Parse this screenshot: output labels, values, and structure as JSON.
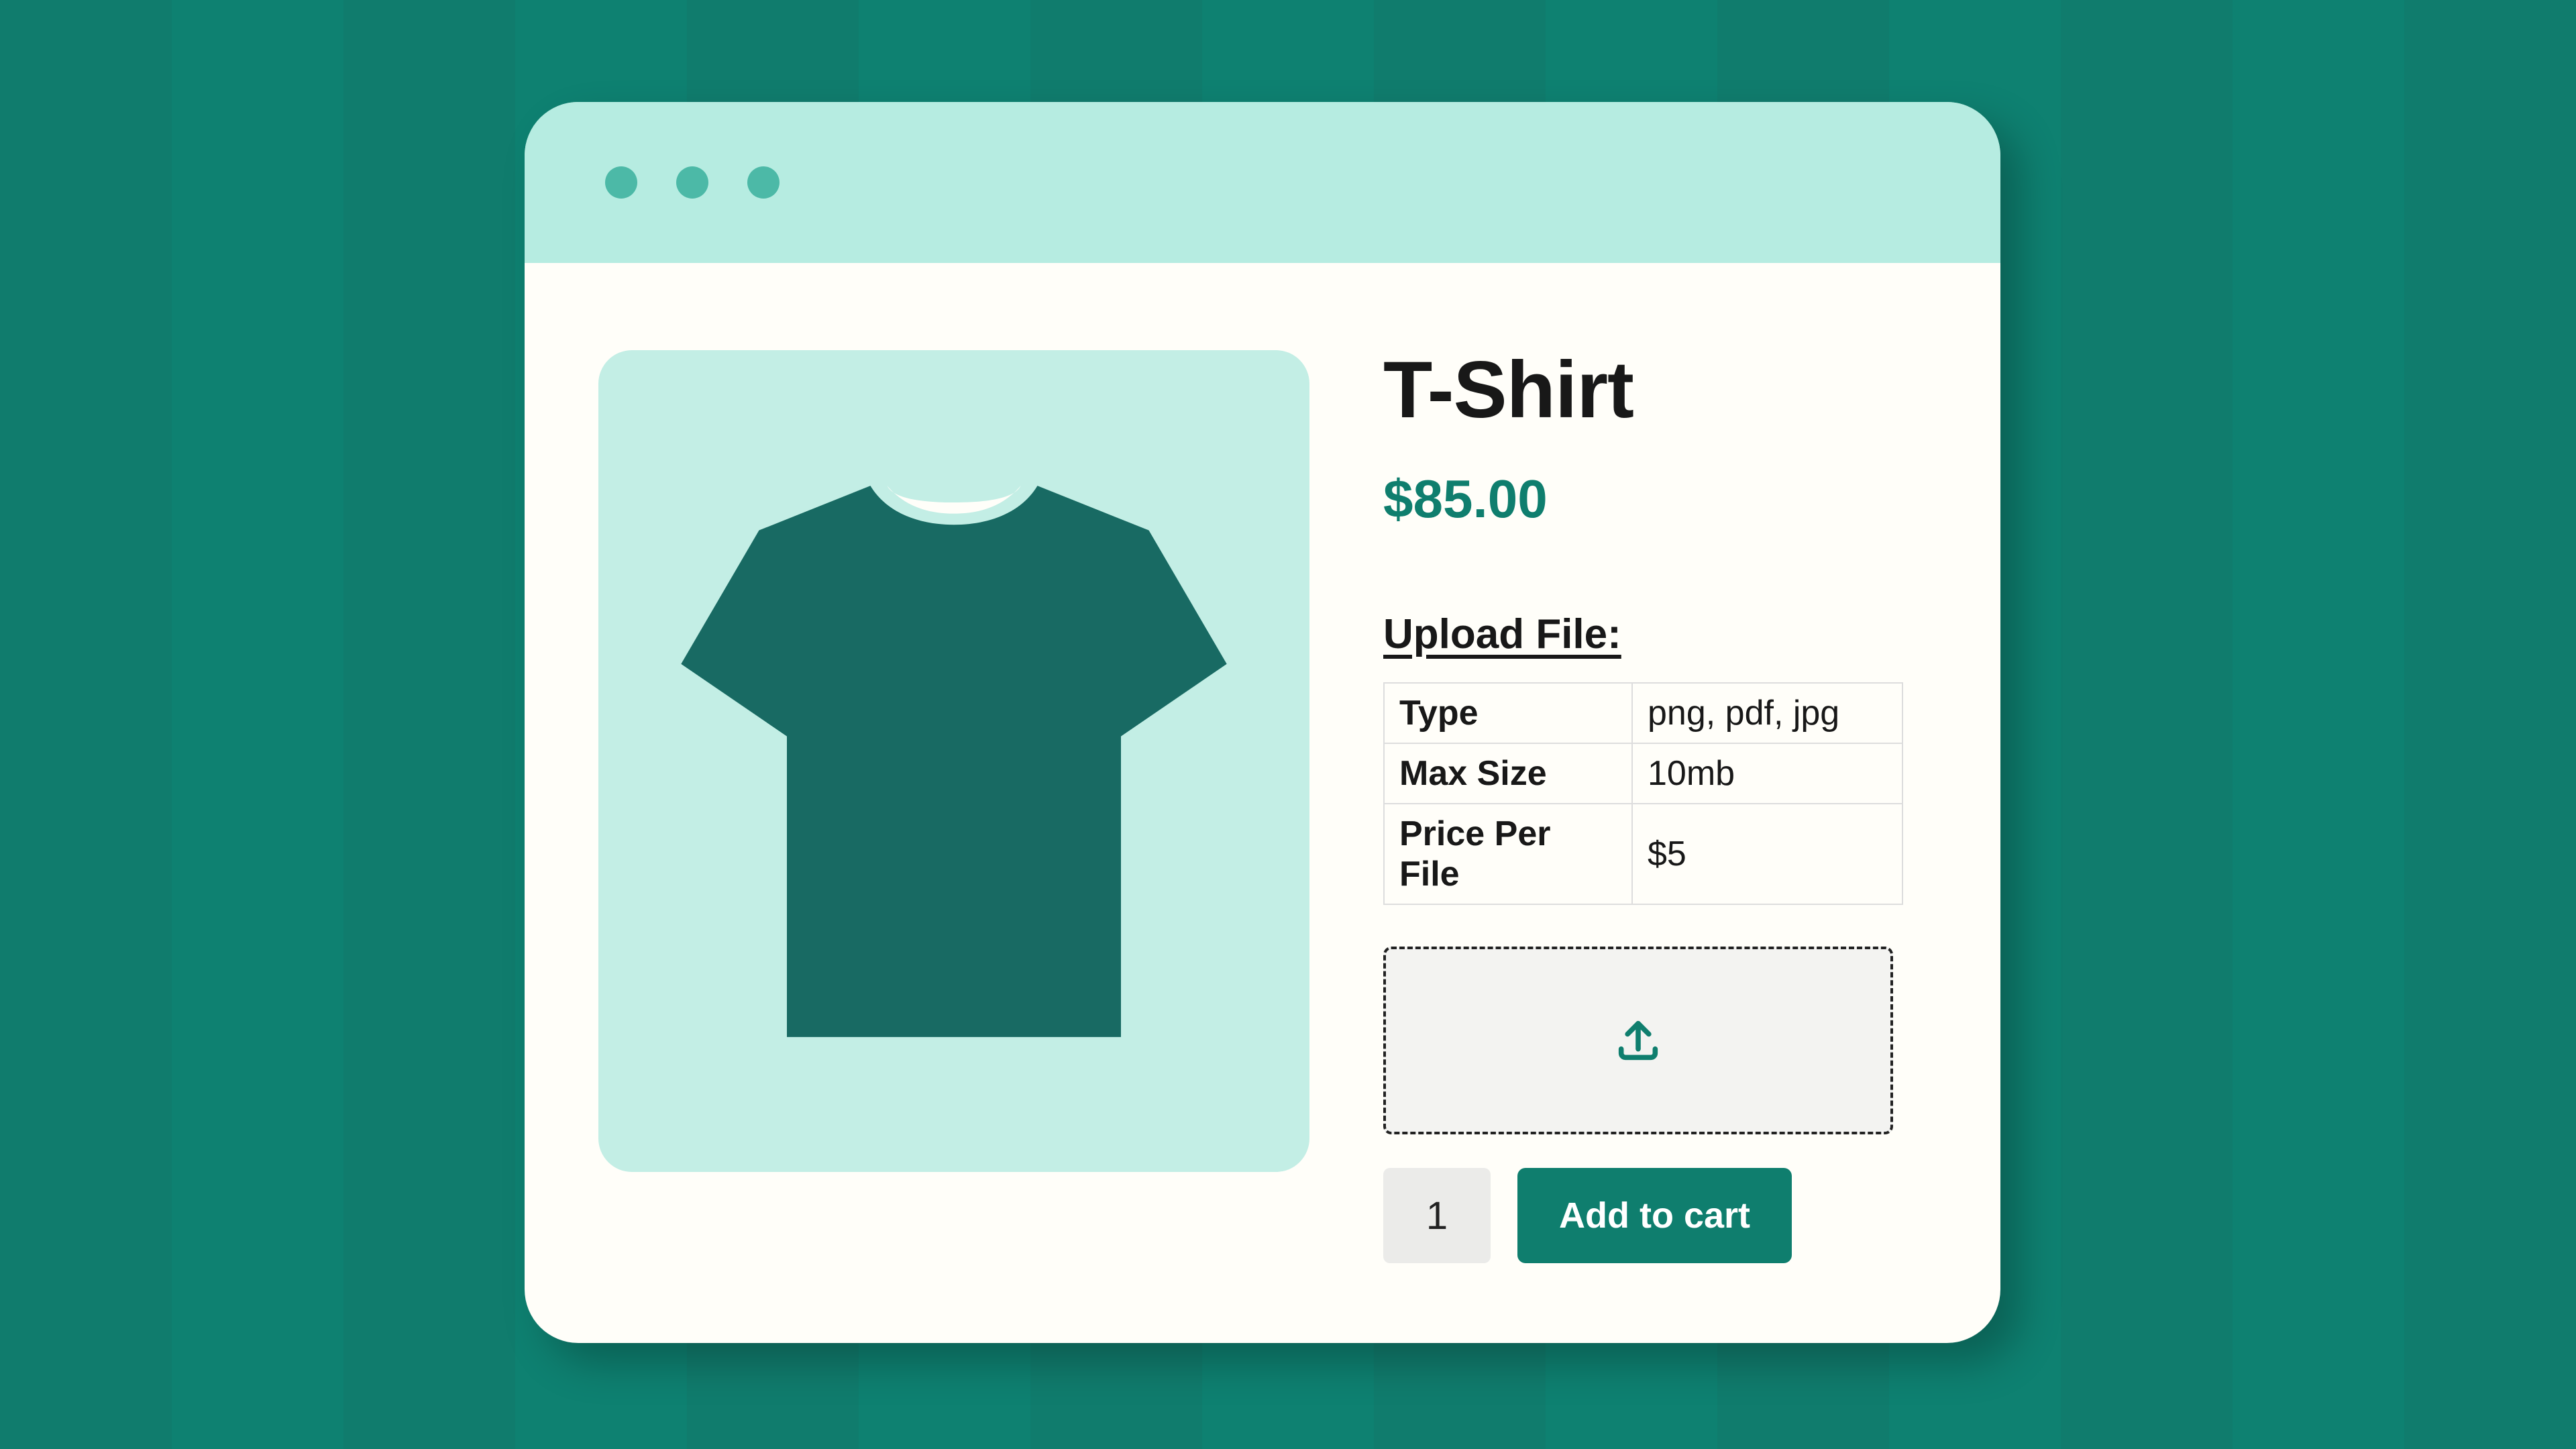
{
  "product": {
    "title": "T-Shirt",
    "price": "$85.00"
  },
  "upload": {
    "heading": "Upload File:",
    "specs": [
      {
        "label": "Type",
        "value": "png, pdf, jpg"
      },
      {
        "label": "Max Size",
        "value": "10mb"
      },
      {
        "label": "Price Per File",
        "value": "$5"
      }
    ]
  },
  "cart": {
    "quantity": "1",
    "add_label": "Add to cart"
  },
  "colors": {
    "brand": "#0f7e6e",
    "titlebar": "#b6ece1",
    "imagebox": "#c3eee5"
  }
}
